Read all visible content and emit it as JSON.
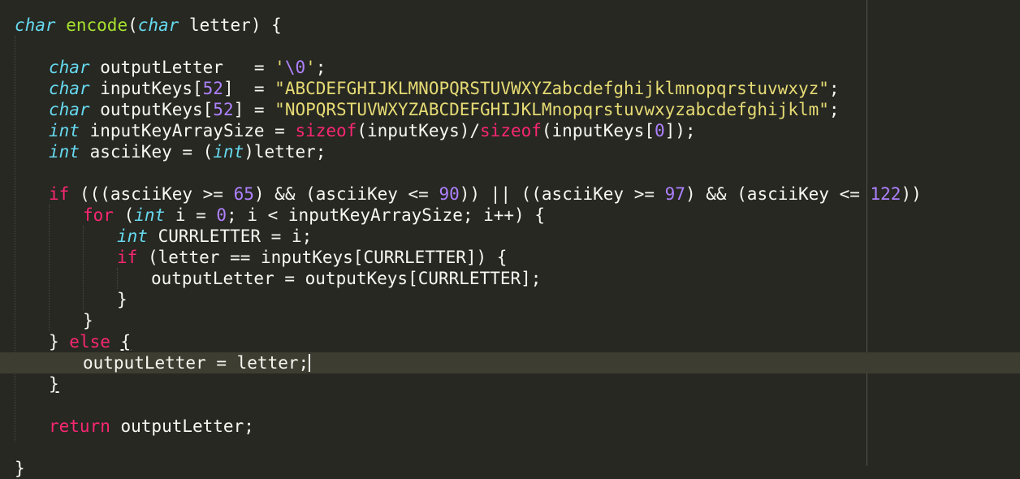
{
  "editor": {
    "lines": [
      [
        [
          "ty",
          "char"
        ],
        [
          "p",
          " "
        ],
        [
          "fn",
          "encode"
        ],
        [
          "p",
          "("
        ],
        [
          "ty",
          "char"
        ],
        [
          "p",
          " letter) {"
        ]
      ],
      [],
      [
        [
          "ty",
          "char"
        ],
        [
          "p",
          " outputLetter   = "
        ],
        [
          "str",
          "'"
        ],
        [
          "esc",
          "\\0"
        ],
        [
          "str",
          "'"
        ],
        [
          "p",
          ";"
        ]
      ],
      [
        [
          "ty",
          "char"
        ],
        [
          "p",
          " inputKeys["
        ],
        [
          "num",
          "52"
        ],
        [
          "p",
          "]  = "
        ],
        [
          "str",
          "\"ABCDEFGHIJKLMNOPQRSTUVWXYZabcdefghijklmnopqrstuvwxyz\""
        ],
        [
          "p",
          ";"
        ]
      ],
      [
        [
          "ty",
          "char"
        ],
        [
          "p",
          " outputKeys["
        ],
        [
          "num",
          "52"
        ],
        [
          "p",
          "] = "
        ],
        [
          "str",
          "\"NOPQRSTUVWXYZABCDEFGHIJKLMnopqrstuvwxyzabcdefghijklm\""
        ],
        [
          "p",
          ";"
        ]
      ],
      [
        [
          "ty",
          "int"
        ],
        [
          "p",
          " inputKeyArraySize = "
        ],
        [
          "kw",
          "sizeof"
        ],
        [
          "p",
          "(inputKeys)/"
        ],
        [
          "kw",
          "sizeof"
        ],
        [
          "p",
          "(inputKeys["
        ],
        [
          "num",
          "0"
        ],
        [
          "p",
          "]);"
        ]
      ],
      [
        [
          "ty",
          "int"
        ],
        [
          "p",
          " asciiKey = ("
        ],
        [
          "ty",
          "int"
        ],
        [
          "p",
          ")letter;"
        ]
      ],
      [],
      [
        [
          "kw",
          "if"
        ],
        [
          "p",
          " (((asciiKey >= "
        ],
        [
          "num",
          "65"
        ],
        [
          "p",
          ") && (asciiKey <= "
        ],
        [
          "num",
          "90"
        ],
        [
          "p",
          ")) || ((asciiKey >= "
        ],
        [
          "num",
          "97"
        ],
        [
          "p",
          ") && (asciiKey <= "
        ],
        [
          "num",
          "122"
        ],
        [
          "p",
          "))"
        ]
      ],
      [
        [
          "kw",
          "for"
        ],
        [
          "p",
          " ("
        ],
        [
          "ty",
          "int"
        ],
        [
          "p",
          " i = "
        ],
        [
          "num",
          "0"
        ],
        [
          "p",
          "; i < inputKeyArraySize; i++) {"
        ]
      ],
      [
        [
          "ty",
          "int"
        ],
        [
          "p",
          " CURRLETTER = i;"
        ]
      ],
      [
        [
          "kw",
          "if"
        ],
        [
          "p",
          " (letter == inputKeys[CURRLETTER]) {"
        ]
      ],
      [
        [
          "p",
          "outputLetter = outputKeys[CURRLETTER];"
        ]
      ],
      [
        [
          "p",
          "}"
        ]
      ],
      [
        [
          "p",
          "}"
        ]
      ],
      [
        [
          "p",
          "} "
        ],
        [
          "kw",
          "else"
        ],
        [
          "p",
          " "
        ],
        [
          "ul",
          "{"
        ]
      ],
      [
        [
          "p",
          "outputLetter = letter;"
        ]
      ],
      [
        [
          "ul",
          "}"
        ]
      ],
      [],
      [
        [
          "kw",
          "return"
        ],
        [
          "p",
          " outputLetter;"
        ]
      ],
      [],
      [
        [
          "p",
          "}"
        ]
      ]
    ],
    "current_line": 16,
    "colors": {
      "background": "#272822",
      "keyword": "#f92672",
      "type": "#66d9ef",
      "function": "#a6e22e",
      "number": "#ae81ff",
      "string": "#e6db74"
    }
  }
}
